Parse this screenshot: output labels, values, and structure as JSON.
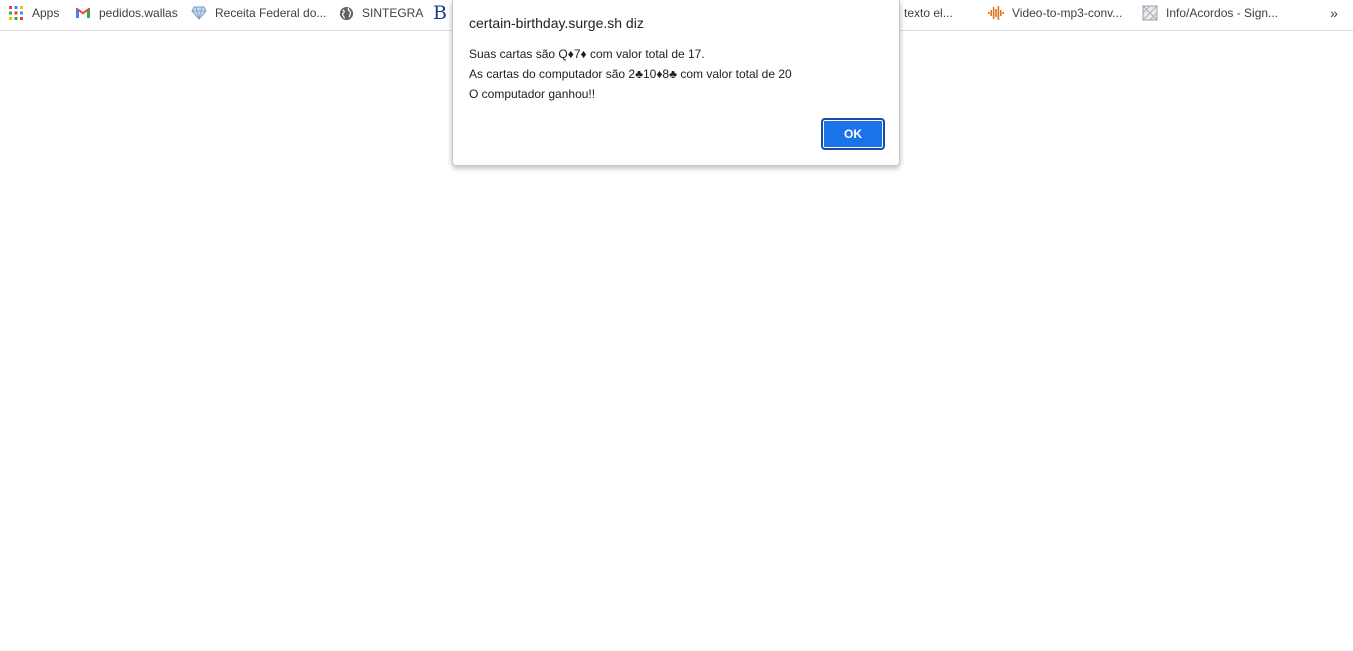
{
  "bookmarks": {
    "apps": {
      "label": "Apps",
      "icon": "apps-grid-icon"
    },
    "items": [
      {
        "label": "pedidos.wallas",
        "icon": "gmail-icon"
      },
      {
        "label": "Receita Federal do...",
        "icon": "diamond-icon"
      },
      {
        "label": "SINTEGRA",
        "icon": "globe-icon"
      },
      {
        "label": "",
        "icon": "b-letter-icon"
      },
      {
        "label": "r de texto el...",
        "icon": ""
      },
      {
        "label": "Video-to-mp3-conv...",
        "icon": "audio-wave-icon"
      },
      {
        "label": "Info/Acordos - Sign...",
        "icon": "document-icon"
      }
    ],
    "more_label": "»"
  },
  "dialog": {
    "title": "certain-birthday.surge.sh diz",
    "lines": [
      "Suas cartas são Q♦7♦ com valor total de 17.",
      "As cartas do computador são 2♣10♦8♣ com valor total de 20",
      "O computador ganhou!!"
    ],
    "ok_label": "OK"
  },
  "colors": {
    "accent": "#1a73e8",
    "gmail_red": "#ea4335",
    "audio_orange": "#e8711a"
  }
}
